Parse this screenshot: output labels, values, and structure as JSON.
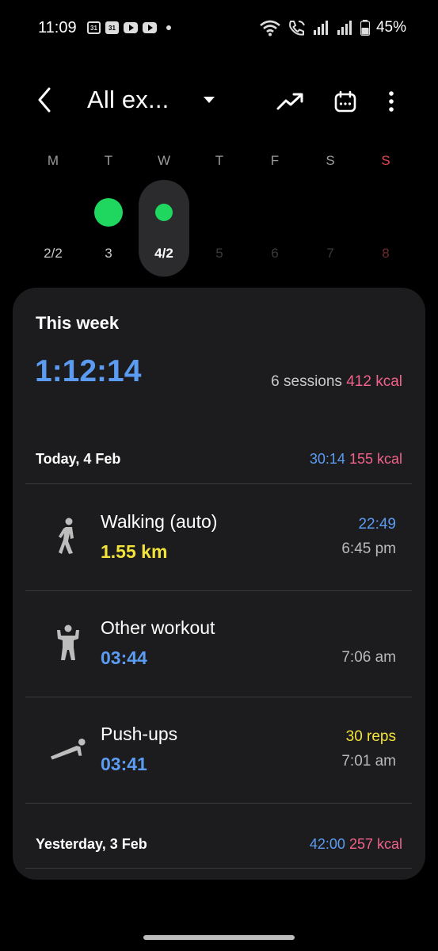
{
  "status_bar": {
    "time": "11:09",
    "calendar_icon_a": "31",
    "calendar_icon_b": "31",
    "battery": "45%"
  },
  "header": {
    "title": "All ex...",
    "icons": [
      "back-arrow-icon",
      "dropdown-triangle-icon",
      "trend-icon",
      "calendar-icon",
      "more-vert-icon"
    ]
  },
  "week_strip": {
    "days": [
      {
        "letter": "M",
        "number": "2/2",
        "dot": "none",
        "state": "past"
      },
      {
        "letter": "T",
        "number": "3",
        "dot": "big",
        "state": "past"
      },
      {
        "letter": "W",
        "number": "4/2",
        "dot": "small",
        "state": "selected"
      },
      {
        "letter": "T",
        "number": "5",
        "dot": "none",
        "state": "future"
      },
      {
        "letter": "F",
        "number": "6",
        "dot": "none",
        "state": "future"
      },
      {
        "letter": "S",
        "number": "7",
        "dot": "none",
        "state": "future"
      },
      {
        "letter": "S",
        "number": "8",
        "dot": "none",
        "state": "future-sunday"
      }
    ]
  },
  "summary": {
    "label": "This week",
    "total_time": "1:12:14",
    "sessions": "6 sessions",
    "kcal": "412 kcal"
  },
  "today": {
    "date": "Today, 4 Feb",
    "time": "30:14",
    "kcal": "155 kcal"
  },
  "entries": [
    {
      "icon": "walking-icon",
      "name": "Walking (auto)",
      "value": "1.55 km",
      "value_color": "#f2e33a",
      "right_top": "22:49",
      "right_top_color": "#5b9cf2",
      "right_bottom": "6:45 pm"
    },
    {
      "icon": "workout-icon",
      "name": "Other workout",
      "value": "03:44",
      "value_color": "#5b9cf2",
      "right_top": "",
      "right_top_color": "#5b9cf2",
      "right_bottom": "7:06 am"
    },
    {
      "icon": "push-up-icon",
      "name": "Push-ups",
      "value": "03:41",
      "value_color": "#5b9cf2",
      "right_top": "30 reps",
      "right_top_color": "#f2e33a",
      "right_bottom": "7:01 am"
    }
  ],
  "yesterday": {
    "date": "Yesterday, 3 Feb",
    "time": "42:00",
    "kcal": "257 kcal"
  },
  "colors": {
    "accent_blue": "#5b9cf2",
    "accent_pink": "#f0628a",
    "accent_yellow": "#f2e33a",
    "dot_green": "#1fd65f",
    "sunday_red": "#e0474f"
  }
}
